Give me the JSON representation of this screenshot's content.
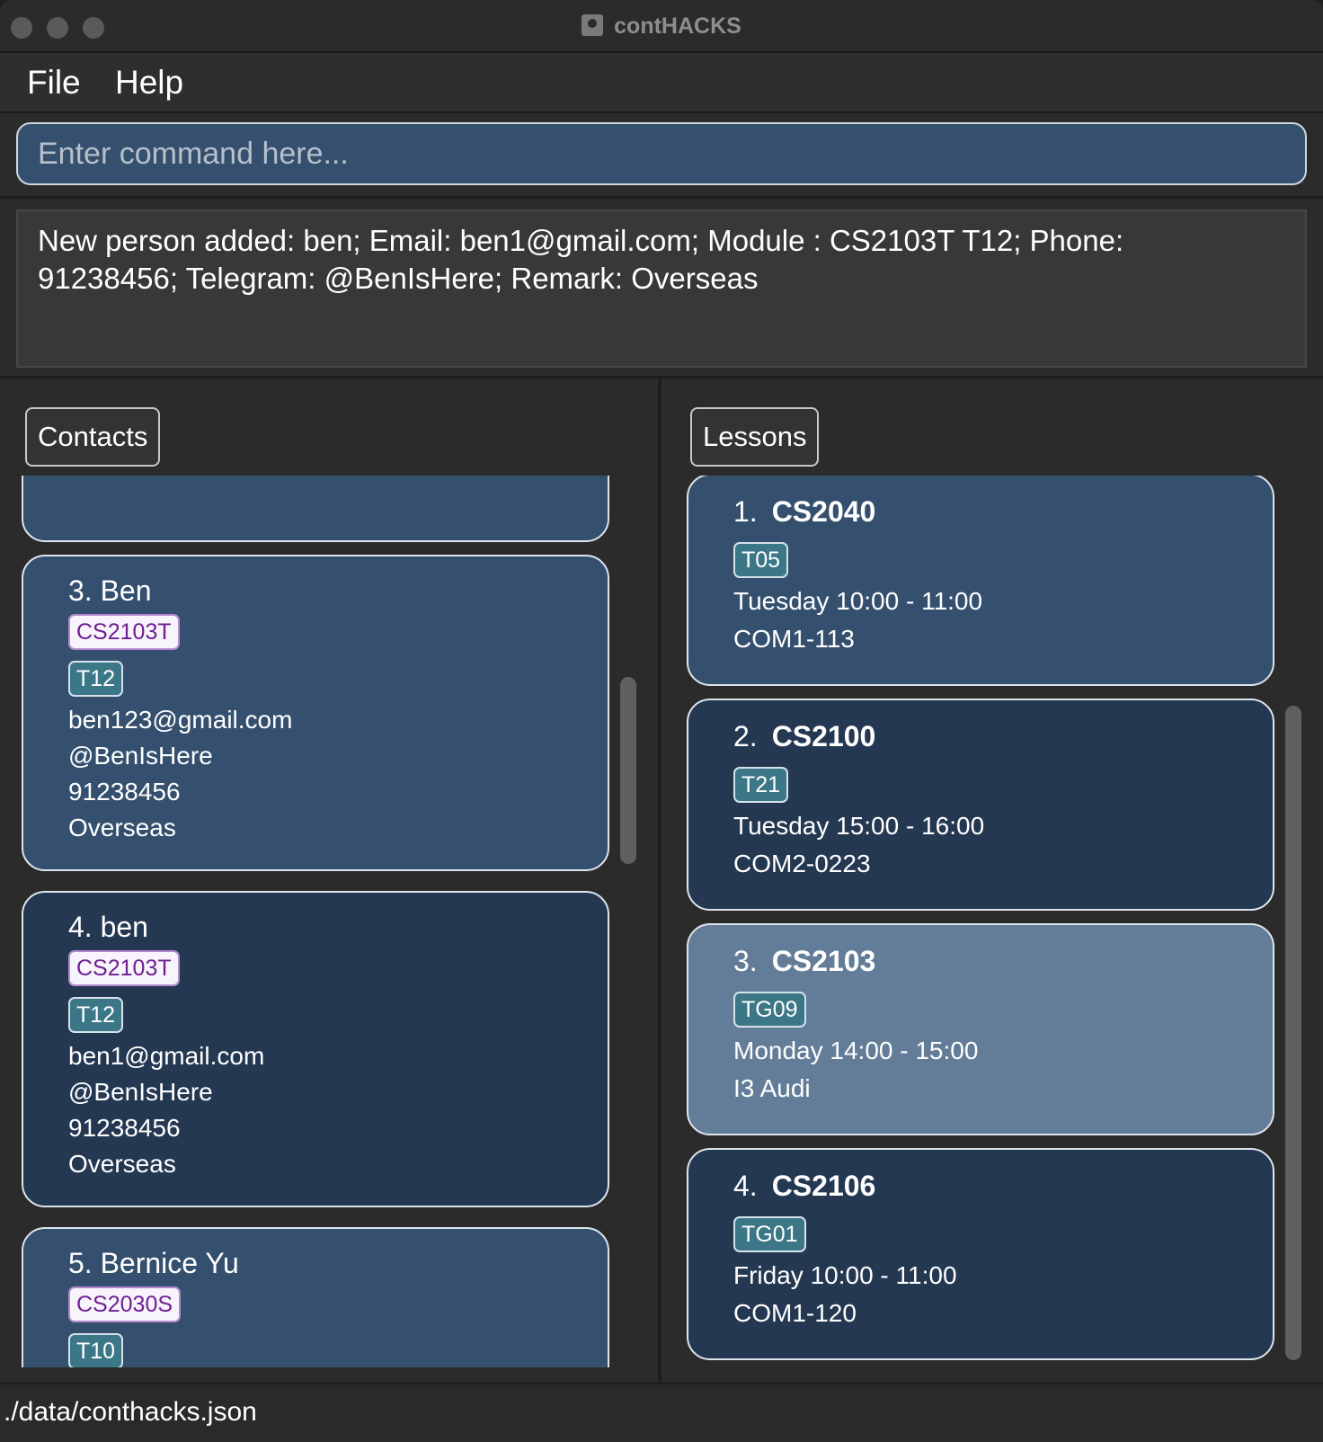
{
  "window": {
    "title": "contHACKS"
  },
  "menu": {
    "file": "File",
    "help": "Help"
  },
  "command": {
    "placeholder": "Enter command here..."
  },
  "result": {
    "line1": "New person added: ben; Email: ben1@gmail.com; Module : CS2103T T12; Phone:",
    "line2": "91238456; Telegram: @BenIsHere; Remark: Overseas"
  },
  "contacts": {
    "label": "Contacts",
    "items": [
      {
        "name": "3. Ben",
        "module": "CS2103T",
        "group": "T12",
        "email": "ben123@gmail.com",
        "telegram": "@BenIsHere",
        "phone": "91238456",
        "remark": "Overseas"
      },
      {
        "name": "4. ben",
        "module": "CS2103T",
        "group": "T12",
        "email": "ben1@gmail.com",
        "telegram": "@BenIsHere",
        "phone": "91238456",
        "remark": "Overseas"
      },
      {
        "name": "5. Bernice Yu",
        "module": "CS2030S",
        "group": "T10"
      }
    ]
  },
  "lessons": {
    "label": "Lessons",
    "items": [
      {
        "num": "1.",
        "code": "CS2040",
        "group": "T05",
        "time": "Tuesday  10:00 - 11:00",
        "venue": "COM1-113"
      },
      {
        "num": "2.",
        "code": "CS2100",
        "group": "T21",
        "time": "Tuesday  15:00 - 16:00",
        "venue": "COM2-0223"
      },
      {
        "num": "3.",
        "code": "CS2103",
        "group": "TG09",
        "time": "Monday  14:00 - 15:00",
        "venue": "I3 Audi"
      },
      {
        "num": "4.",
        "code": "CS2106",
        "group": "TG01",
        "time": "Friday  10:00 - 11:00",
        "venue": "COM1-120"
      }
    ]
  },
  "status": {
    "path": "./data/conthacks.json"
  },
  "colors": {
    "card_light": "#34506e",
    "card_dark": "#243852",
    "card_selected": "#637d99",
    "module_tag_text": "#6f1f93",
    "group_tag_bg": "#3c7787"
  },
  "icons": {
    "app": "contacts-app-icon"
  }
}
